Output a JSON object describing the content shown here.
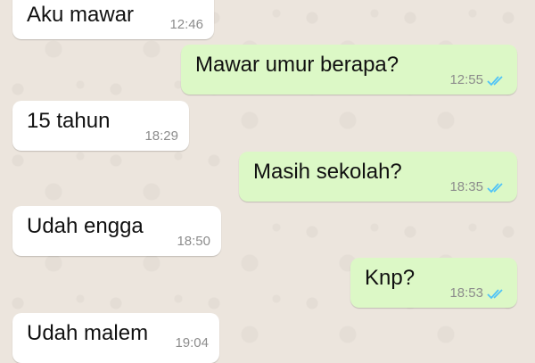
{
  "chat": {
    "messages": [
      {
        "direction": "incoming",
        "text": "Aku mawar",
        "time": "12:46"
      },
      {
        "direction": "outgoing",
        "text": "Mawar umur berapa?",
        "time": "12:55",
        "status": "read"
      },
      {
        "direction": "incoming",
        "text": "15 tahun",
        "time": "18:29"
      },
      {
        "direction": "outgoing",
        "text": "Masih sekolah?",
        "time": "18:35",
        "status": "read"
      },
      {
        "direction": "incoming",
        "text": "Udah engga",
        "time": "18:50"
      },
      {
        "direction": "outgoing",
        "text": "Knp?",
        "time": "18:53",
        "status": "read"
      },
      {
        "direction": "incoming",
        "text": "Udah malem",
        "time": "19:04"
      }
    ]
  },
  "colors": {
    "background": "#ece5dd",
    "incoming_bubble": "#ffffff",
    "outgoing_bubble": "#dcf8c6",
    "read_tick": "#4fc3f7",
    "timestamp": "#8c8c8c"
  },
  "icons": {
    "read_status": "double-check-icon"
  }
}
